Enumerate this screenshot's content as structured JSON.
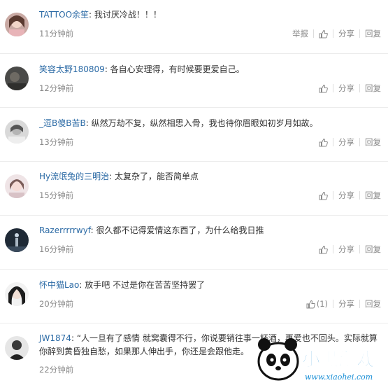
{
  "actions": {
    "report_label": "举报",
    "share_label": "分享",
    "reply_label": "回复",
    "like_icon": "thumb-up-icon"
  },
  "comments": [
    {
      "username": "TATTOO余笙",
      "text": "我讨厌冷战！！！",
      "time": "11分钟前",
      "has_report": true,
      "like_count": ""
    },
    {
      "username": "笑容太野180809",
      "text": "各自心安理得，有时候要更爱自己。",
      "time": "12分钟前",
      "has_report": false,
      "like_count": ""
    },
    {
      "username": "_逗B傻B苦B",
      "text": "纵然万劫不复，纵然相思入骨，我也待你眉眼如初岁月如故。",
      "time": "13分钟前",
      "has_report": false,
      "like_count": ""
    },
    {
      "username": "Hy流氓兔的三明治",
      "text": "太复杂了，能否简单点",
      "time": "15分钟前",
      "has_report": false,
      "like_count": ""
    },
    {
      "username": "Razerrrrrwyf",
      "text": "很久都不记得爱情这东西了，为什么给我日推",
      "time": "16分钟前",
      "has_report": false,
      "like_count": ""
    },
    {
      "username": "怀中猫Lao",
      "text": "放手吧 不过是你在苦苦坚持罢了",
      "time": "20分钟前",
      "has_report": false,
      "like_count": "(1)"
    },
    {
      "username": "JW1874",
      "text": "“人一旦有了感情 就窝囊得不行，你说要销往事一杯酒，再爱也不回头。实际就算你醉到黄昏独自愁，如果那人伸出手，你还是会跟他走。",
      "time": "22分钟前",
      "has_report": false,
      "like_count": ""
    }
  ],
  "watermark": {
    "logo_text": "小黑游戏",
    "url_text": "www.xiaohei.com"
  }
}
